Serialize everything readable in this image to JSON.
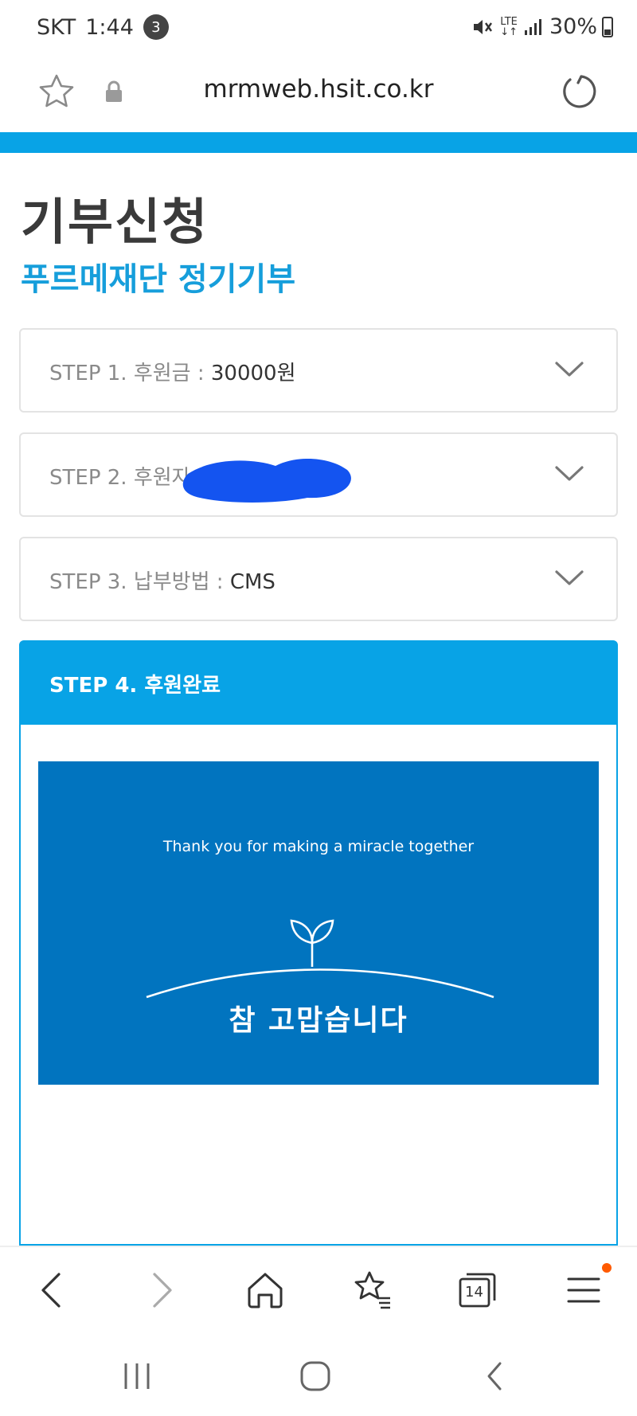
{
  "status": {
    "carrier": "SKT",
    "time": "1:44",
    "notif_count": "3",
    "network": "LTE",
    "battery": "30%"
  },
  "browser": {
    "url": "mrmweb.hsit.co.kr",
    "tab_count": "14"
  },
  "page": {
    "title": "기부신청",
    "subtitle": "푸르메재단 정기기부"
  },
  "steps": [
    {
      "label": "STEP 1. 후원금 : ",
      "value": "30000원"
    },
    {
      "label": "STEP 2. 후원자",
      "value": ""
    },
    {
      "label": "STEP 3. 납부방법 : ",
      "value": "CMS"
    }
  ],
  "step4": {
    "header": "STEP 4. 후원완료",
    "thank_en": "Thank you for making a miracle together",
    "thank_ko": "참 고맙습니다"
  },
  "colors": {
    "accent": "#08a3e6",
    "card": "#0174bf",
    "redaction": "#1454f0"
  },
  "icons": [
    "star-icon",
    "lock-icon",
    "reload-icon",
    "chevron-down-icon",
    "back-icon",
    "forward-icon",
    "home-icon",
    "bookmarks-icon",
    "tabs-icon",
    "menu-icon"
  ]
}
